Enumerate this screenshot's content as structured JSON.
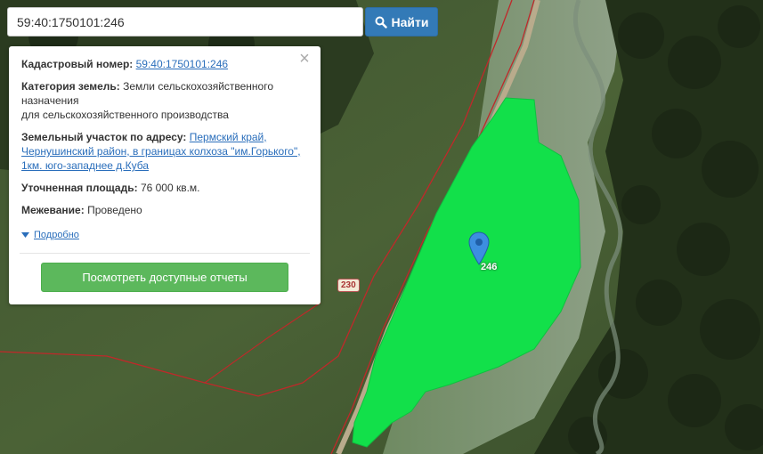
{
  "search": {
    "value": "59:40:1750101:246",
    "button_label": "Найти"
  },
  "info": {
    "close_symbol": "×",
    "cadastral": {
      "label": "Кадастровый номер:",
      "value": "59:40:1750101:246"
    },
    "category": {
      "label": "Категория земель:",
      "value_line1": "Земли сельскохозяйственного назначения",
      "value_line2": "для сельскохозяйственного производства"
    },
    "address": {
      "label": "Земельный участок по адресу:",
      "line1": "Пермский край,",
      "line2": "Чернушинский район, в границах колхоза \"им.Горького\",",
      "line3": "1км. юго-западнее д.Куба"
    },
    "area": {
      "label": "Уточненная площадь:",
      "value": "76 000 кв.м."
    },
    "survey": {
      "label": "Межевание:",
      "value": "Проведено"
    },
    "details_label": "Подробно",
    "reports_button": "Посмотреть доступные отчеты"
  },
  "map": {
    "road_number": "230",
    "parcel_label": "246",
    "colors": {
      "parcel_fill": "#12e04a",
      "boundary": "#c0282a",
      "marker": "#3d8ee0",
      "search_button": "#337ab7",
      "reports_button": "#5cb85c"
    }
  }
}
